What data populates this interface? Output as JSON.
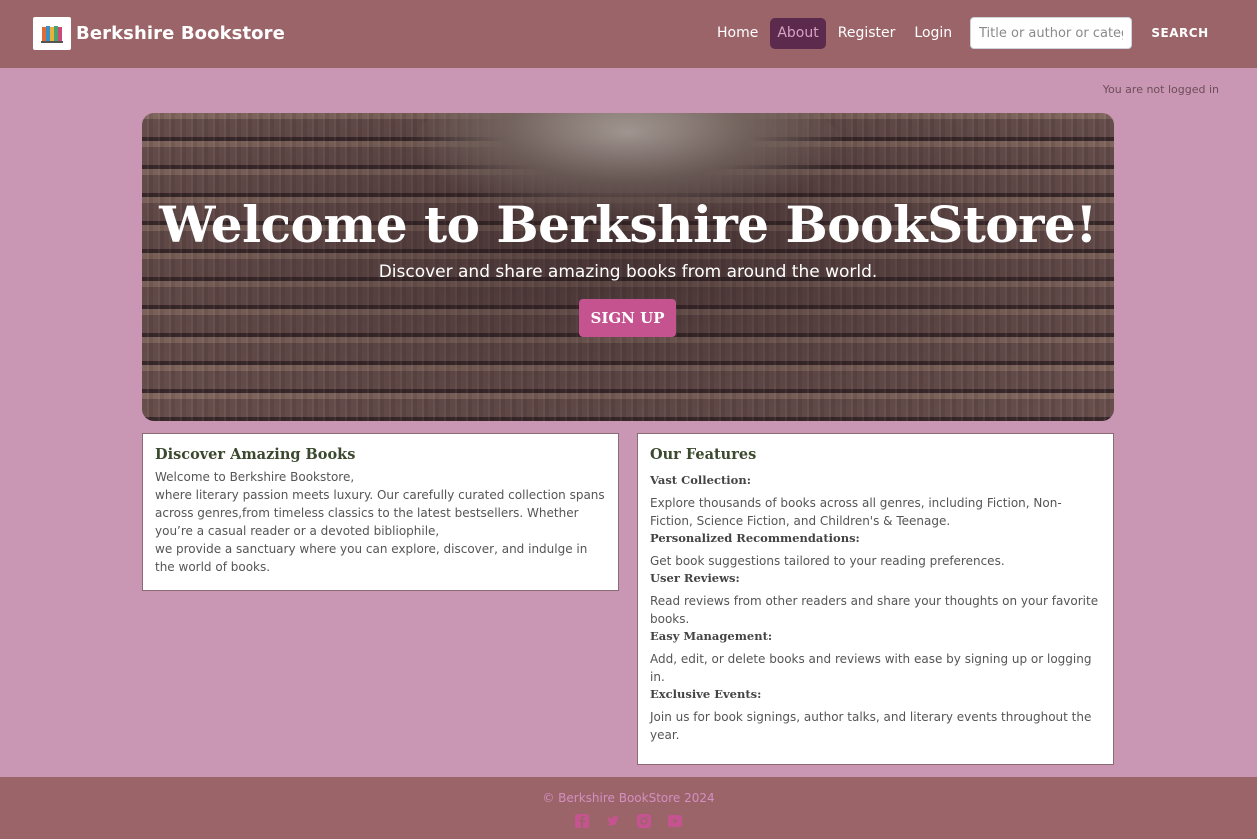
{
  "nav": {
    "brand_name": "Berkshire Bookstore",
    "links": [
      {
        "label": "Home",
        "active": false
      },
      {
        "label": "About",
        "active": true
      },
      {
        "label": "Register",
        "active": false
      },
      {
        "label": "Login",
        "active": false
      }
    ],
    "search_placeholder": "Title or author or category",
    "search_button": "SEARCH"
  },
  "login_status": "You are not logged in",
  "hero": {
    "title": "Welcome to Berkshire BookStore!",
    "subtitle": "Discover and share amazing books from around the world.",
    "cta": "SIGN UP"
  },
  "discover": {
    "title": "Discover Amazing Books",
    "lines": [
      "Welcome to Berkshire Bookstore,",
      "where literary passion meets luxury. Our carefully curated collection spans across genres,from timeless classics to the latest bestsellers. Whether you’re a casual reader or a devoted bibliophile,",
      "we provide a sanctuary where you can explore, discover, and indulge in the world of books."
    ]
  },
  "features": {
    "title": "Our Features",
    "items": [
      {
        "name": "Vast Collection:",
        "desc": "Explore thousands of books across all genres, including Fiction, Non-Fiction, Science Fiction, and Children's & Teenage."
      },
      {
        "name": "Personalized Recommendations:",
        "desc": "Get book suggestions tailored to your reading preferences."
      },
      {
        "name": "User Reviews:",
        "desc": "Read reviews from other readers and share your thoughts on your favorite books."
      },
      {
        "name": "Easy Management:",
        "desc": "Add, edit, or delete books and reviews with ease by signing up or logging in."
      },
      {
        "name": "Exclusive Events:",
        "desc": "Join us for book signings, author talks, and literary events throughout the year."
      }
    ]
  },
  "footer": {
    "copyright": "© Berkshire BookStore 2024",
    "social": [
      "facebook-icon",
      "twitter-icon",
      "instagram-icon",
      "youtube-icon"
    ]
  },
  "colors": {
    "navbar": "#9b6469",
    "page_bg": "#c997b3",
    "accent": "#c55390",
    "active_nav": "#5c2a4c"
  }
}
